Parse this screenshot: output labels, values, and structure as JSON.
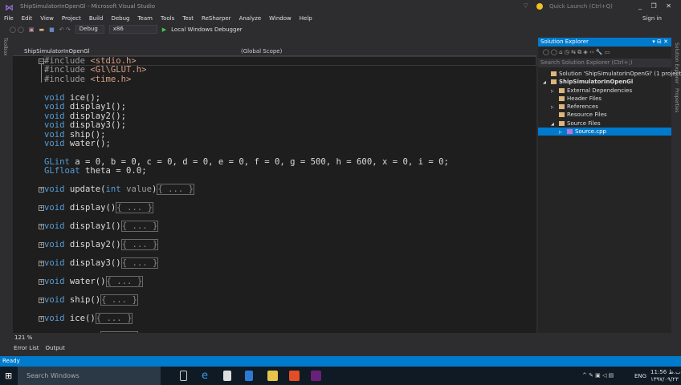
{
  "window": {
    "title": "ShipSimulatorInOpenGl - Microsoft Visual Studio",
    "quick_launch_placeholder": "Quick Launch (Ctrl+Q)",
    "sign_in": "Sign in",
    "controls": "_ ❐ ✕"
  },
  "menu": [
    "File",
    "Edit",
    "View",
    "Project",
    "Build",
    "Debug",
    "Team",
    "Tools",
    "Test",
    "ReSharper",
    "Analyze",
    "Window",
    "Help"
  ],
  "toolbar": {
    "configuration": "Debug",
    "platform": "x86",
    "debugger": "Local Windows Debugger"
  },
  "toolbox_label": "Toolbox",
  "editor": {
    "project_combo": "ShipSimulatorInOpenGl",
    "scope_combo": "(Global Scope)",
    "zoom": "121 %",
    "lines": [
      [
        {
          "t": "#include ",
          "c": "pp"
        },
        {
          "t": "<stdio.h>",
          "c": "str"
        }
      ],
      [
        {
          "t": "#include ",
          "c": "pp"
        },
        {
          "t": "<Gl\\GLUT.h>",
          "c": "str"
        }
      ],
      [
        {
          "t": "#include ",
          "c": "pp"
        },
        {
          "t": "<time.h>",
          "c": "str"
        }
      ],
      [],
      [
        {
          "t": "void",
          "c": "kw"
        },
        {
          "t": " ice();",
          "c": ""
        }
      ],
      [
        {
          "t": "void",
          "c": "kw"
        },
        {
          "t": " display1();",
          "c": ""
        }
      ],
      [
        {
          "t": "void",
          "c": "kw"
        },
        {
          "t": " display2();",
          "c": ""
        }
      ],
      [
        {
          "t": "void",
          "c": "kw"
        },
        {
          "t": " display3();",
          "c": ""
        }
      ],
      [
        {
          "t": "void",
          "c": "kw"
        },
        {
          "t": " ship();",
          "c": ""
        }
      ],
      [
        {
          "t": "void",
          "c": "kw"
        },
        {
          "t": " water();",
          "c": ""
        }
      ],
      [],
      [
        {
          "t": "GLint",
          "c": "kw"
        },
        {
          "t": " a = 0, b = 0, c = 0, d = 0, e = 0, f = 0, g = 500, h = 600, x = 0, i = 0;",
          "c": ""
        }
      ],
      [
        {
          "t": "GLfloat",
          "c": "kw"
        },
        {
          "t": " theta = 0.0;",
          "c": ""
        }
      ],
      [],
      [
        {
          "t": "void",
          "c": "kw"
        },
        {
          "t": " update(",
          "c": ""
        },
        {
          "t": "int",
          "c": "kw"
        },
        {
          "t": " value",
          "c": "par"
        },
        {
          "t": ")",
          "c": ""
        },
        {
          "t": "{ ... }",
          "c": "col"
        }
      ],
      [],
      [
        {
          "t": "void",
          "c": "kw"
        },
        {
          "t": " display()",
          "c": ""
        },
        {
          "t": "{ ... }",
          "c": "col"
        }
      ],
      [],
      [
        {
          "t": "void",
          "c": "kw"
        },
        {
          "t": " display1()",
          "c": ""
        },
        {
          "t": "{ ... }",
          "c": "col"
        }
      ],
      [],
      [
        {
          "t": "void",
          "c": "kw"
        },
        {
          "t": " display2()",
          "c": ""
        },
        {
          "t": "{ ... }",
          "c": "col"
        }
      ],
      [],
      [
        {
          "t": "void",
          "c": "kw"
        },
        {
          "t": " display3()",
          "c": ""
        },
        {
          "t": "{ ... }",
          "c": "col"
        }
      ],
      [],
      [
        {
          "t": "void",
          "c": "kw"
        },
        {
          "t": " water()",
          "c": ""
        },
        {
          "t": "{ ... }",
          "c": "col"
        }
      ],
      [],
      [
        {
          "t": "void",
          "c": "kw"
        },
        {
          "t": " ship()",
          "c": ""
        },
        {
          "t": "{ ... }",
          "c": "col"
        }
      ],
      [],
      [
        {
          "t": "void",
          "c": "kw"
        },
        {
          "t": " ice()",
          "c": ""
        },
        {
          "t": "{ ... }",
          "c": "col"
        }
      ],
      [],
      [
        {
          "t": "void",
          "c": "kw"
        },
        {
          "t": " init()",
          "c": ""
        },
        {
          "t": "{ ... }",
          "c": "col"
        }
      ]
    ]
  },
  "bottom_tabs": [
    "Error List",
    "Output"
  ],
  "status": "Ready",
  "solution_explorer": {
    "title": "Solution Explorer",
    "search_placeholder": "Search Solution Explorer (Ctrl+;)",
    "nodes": [
      {
        "label": "Solution 'ShipSimulatorInOpenGl' (1 project)",
        "depth": 0,
        "arrow": ""
      },
      {
        "label": "ShipSimulatorInOpenGl",
        "depth": 0,
        "arrow": "◢",
        "bold": true
      },
      {
        "label": "External Dependencies",
        "depth": 1,
        "arrow": "▷"
      },
      {
        "label": "Header Files",
        "depth": 1,
        "arrow": ""
      },
      {
        "label": "References",
        "depth": 1,
        "arrow": "▷"
      },
      {
        "label": "Resource Files",
        "depth": 1,
        "arrow": ""
      },
      {
        "label": "Source Files",
        "depth": 1,
        "arrow": "◢"
      },
      {
        "label": "Source.cpp",
        "depth": 2,
        "arrow": "▷",
        "selected": true
      }
    ]
  },
  "right_strip": [
    "Solution Explorer",
    "Properties"
  ],
  "taskbar": {
    "search": "Search Windows",
    "lang": "ENG",
    "time": "11:56 ب.ظ",
    "date": "۱۳۹۷/۰۹/۲۳"
  },
  "colors": {
    "accent": "#007acc",
    "keyword": "#569cd6",
    "string": "#d69d85",
    "editor_bg": "#1e1e1e"
  }
}
